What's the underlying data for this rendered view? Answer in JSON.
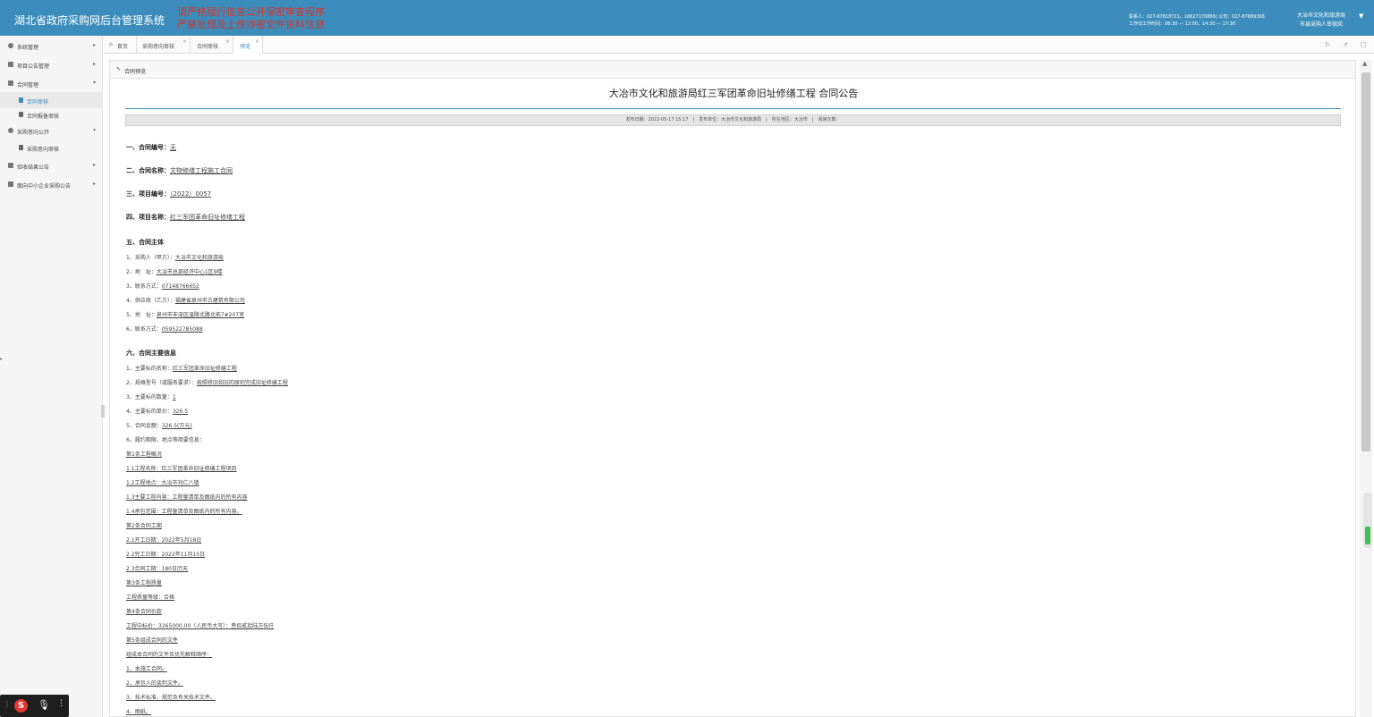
{
  "header": {
    "title": "湖北省政府采购网后台管理系统",
    "warning": [
      "请严格履行信息公开保密审查程序",
      "严禁处理及上传涉密文件资料信息"
    ],
    "contact_lines": [
      "联系人：027-87818721，18627170886| 公司：027-87889366",
      "工作日工作时间：08:30 — 12:00，14:30 — 17:30"
    ],
    "user_lines": [
      "大冶市文化和旅游局",
      "市县采购人审核岗"
    ]
  },
  "sidebar": {
    "items": [
      {
        "label": "系统管理"
      },
      {
        "label": "项目公告管理"
      },
      {
        "label": "合同管理"
      },
      {
        "label": "合同审核"
      },
      {
        "label": "合同报备审核"
      },
      {
        "label": "采购意向公开"
      },
      {
        "label": "采购意向审核"
      },
      {
        "label": "验收结果公告"
      },
      {
        "label": "面向中小企业采购公告"
      }
    ]
  },
  "tabs": [
    {
      "label": "首页"
    },
    {
      "label": "采购意向审核"
    },
    {
      "label": "合同审核"
    },
    {
      "label": "预览"
    }
  ],
  "panel": {
    "heading": "合同预览",
    "title": "大冶市文化和旅游局红三军团革命旧址修缮工程 合同公告",
    "meta": "发布日期：2022-05-17 15:17　|　发布单位：大冶市文化和旅游局　|　所在地区：大冶市　|　阅读次数："
  },
  "doc": {
    "s1_label": "一、合同编号：",
    "s1_value": "无",
    "s2_label": "二、合同名称：",
    "s2_value": "文物修缮工程施工合同",
    "s3_label": "三、项目编号：",
    "s3_value": "（2022）0057",
    "s4_label": "四、项目名称：",
    "s4_value": "红三军团革命旧址修缮工程",
    "s5_label": "五、合同主体",
    "s5_lines": [
      {
        "k": "1、采购人（甲方）：",
        "v": "大冶市文化和旅游局"
      },
      {
        "k": "2、地　址：",
        "v": "大冶市总部经济中心1区9楼"
      },
      {
        "k": "3、联系方式：",
        "v": "07148766652"
      },
      {
        "k": "4、供应商（乙方）：",
        "v": "福建省泉州市古建筑有限公司"
      },
      {
        "k": "5、地　址：",
        "v": "泉州市丰泽区温陵北路北拓7#207室"
      },
      {
        "k": "6、联系方式：",
        "v": "059522785088"
      }
    ],
    "s6_label": "六、合同主要信息",
    "s6_lines": [
      {
        "k": "1、主要标的名称：",
        "v": "红三军团革命旧址修缮工程"
      },
      {
        "k": "2、规格型号（或服务要求）：",
        "v": "按照修旧如旧的原则完成旧址修缮工程"
      },
      {
        "k": "3、主要标的数量：",
        "v": "1"
      },
      {
        "k": "4、主要标的单价：",
        "v": "326.5"
      },
      {
        "k": "5、合同金额：",
        "v": "326.5(万元)"
      },
      {
        "k": "6、履约期限、地点等简要信息：",
        "v": ""
      }
    ],
    "detail_lines": [
      "第1条工程概况",
      "1.1工程名称：红三军团革命旧址修缮工程项目",
      "1.2工程地点：大冶市刘仁八镇",
      "1.3主要工程内容：工程量清单及图纸内的所有内容",
      "1.4承包范围：工程量清单及图纸内的所有内容。",
      "第2条合同工期",
      "2.1开工日期：2022年5月18日",
      "2.2完工日期：2022年11月15日",
      "2.3合同工期：180日历天",
      "第3条工程质量",
      "工程质量等级：合格",
      "第4条合同价款",
      "工程中标价：3265000.00（人民币大写）：叁佰贰拾陆万伍仟",
      "第5条组成合同的文件",
      "组成本合同的文件及优先解释顺序：",
      "1、本施工合同。",
      "2、承包人的谈判文件。",
      "3、技术标准、规范及有关技术文件。",
      "4、图纸。"
    ]
  },
  "colors": {
    "header_bg": "#3c8dbc",
    "warning_text": "#d9342b",
    "accent": "#3c8dbc"
  },
  "icons": {
    "ime": "sogou-s-icon"
  }
}
